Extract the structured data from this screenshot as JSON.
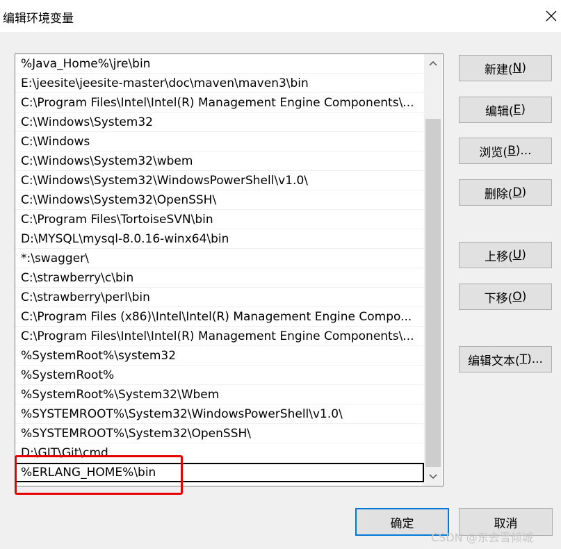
{
  "dialog": {
    "title": "编辑环境变量",
    "close_icon": "close-icon"
  },
  "paths": [
    "%Java_Home%\\jre\\bin",
    "E:\\jeesite\\jeesite-master\\doc\\maven\\maven3\\bin",
    "C:\\Program Files\\Intel\\Intel(R) Management Engine Components\\...",
    "C:\\Windows\\System32",
    "C:\\Windows",
    "C:\\Windows\\System32\\wbem",
    "C:\\Windows\\System32\\WindowsPowerShell\\v1.0\\",
    "C:\\Windows\\System32\\OpenSSH\\",
    "C:\\Program Files\\TortoiseSVN\\bin",
    "D:\\MYSQL\\mysql-8.0.16-winx64\\bin",
    "*:\\swagger\\",
    "C:\\strawberry\\c\\bin",
    "C:\\strawberry\\perl\\bin",
    "C:\\Program Files (x86)\\Intel\\Intel(R) Management Engine Compo...",
    "C:\\Program Files\\Intel\\Intel(R) Management Engine Components\\...",
    "%SystemRoot%\\system32",
    "%SystemRoot%",
    "%SystemRoot%\\System32\\Wbem",
    "%SYSTEMROOT%\\System32\\WindowsPowerShell\\v1.0\\",
    "%SYSTEMROOT%\\System32\\OpenSSH\\",
    "D:\\GIT\\Git\\cmd",
    "%ERLANG_HOME%\\bin"
  ],
  "selected_index": 21,
  "buttons": {
    "new": {
      "text": "新建(",
      "key": "N",
      "end": ")"
    },
    "edit": {
      "text": "编辑(",
      "key": "E",
      "end": ")"
    },
    "browse": {
      "text": "浏览(",
      "key": "B",
      "end": ")..."
    },
    "delete": {
      "text": "删除(",
      "key": "D",
      "end": ")"
    },
    "move_up": {
      "text": "上移(",
      "key": "U",
      "end": ")"
    },
    "move_down": {
      "text": "下移(",
      "key": "O",
      "end": ")"
    },
    "edit_text": {
      "text": "编辑文本(",
      "key": "T",
      "end": ")..."
    },
    "ok": "确定",
    "cancel": "取消"
  },
  "watermark": "CSDN @东去雪倾城",
  "colors": {
    "highlight_box": "#e60000",
    "default_button_border": "#0078d7"
  }
}
